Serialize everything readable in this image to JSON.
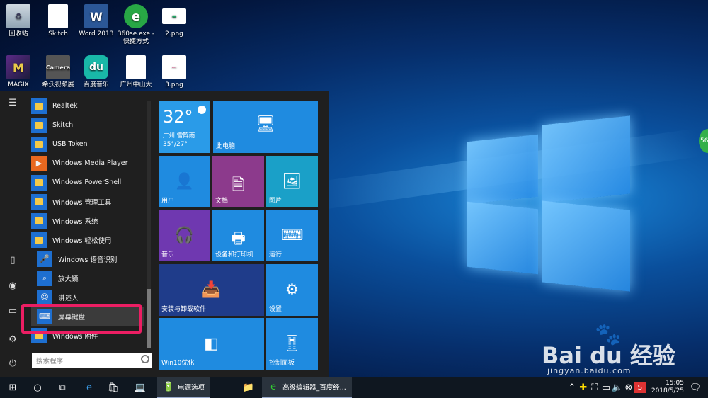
{
  "desktop": {
    "icons": [
      {
        "label": "回收站",
        "glyph": "♻"
      },
      {
        "label": "Skitch",
        "glyph": ""
      },
      {
        "label": "Word 2013",
        "glyph": "W"
      },
      {
        "label": "360se.exe - 快捷方式",
        "glyph": "e"
      },
      {
        "label": "2.png",
        "glyph": "▬"
      },
      {
        "label": "MAGIX",
        "glyph": "M"
      },
      {
        "label": "希沃视频展",
        "glyph": "Camera"
      },
      {
        "label": "百度音乐",
        "glyph": "du"
      },
      {
        "label": "广州中山大",
        "glyph": ""
      },
      {
        "label": "3.png",
        "glyph": "···"
      }
    ]
  },
  "start_menu": {
    "rail": {
      "hamburger": "☰",
      "tablet": "▯",
      "user": "◉",
      "pictures": "▭",
      "settings": "⚙",
      "power": "⏻"
    },
    "apps": [
      {
        "label": "Realtek",
        "type": "folder"
      },
      {
        "label": "Skitch",
        "type": "folder"
      },
      {
        "label": "USB Token",
        "type": "folder"
      },
      {
        "label": "Windows Media Player",
        "type": "app"
      },
      {
        "label": "Windows PowerShell",
        "type": "folder"
      },
      {
        "label": "Windows 管理工具",
        "type": "folder"
      },
      {
        "label": "Windows 系统",
        "type": "folder"
      },
      {
        "label": "Windows 轻松使用",
        "type": "folder"
      },
      {
        "label": "Windows 语音识别",
        "type": "sub"
      },
      {
        "label": "放大镜",
        "type": "sub"
      },
      {
        "label": "讲述人",
        "type": "sub"
      },
      {
        "label": "屏幕键盘",
        "type": "sub-selected"
      },
      {
        "label": "Windows 附件",
        "type": "folder"
      }
    ],
    "search_placeholder": "搜索程序",
    "tiles": {
      "weather": {
        "temp": "32°",
        "city": "广州 雷阵雨",
        "range": "35°/27°"
      },
      "this_pc": "此电脑",
      "users": "用户",
      "docs": "文档",
      "pictures": "图片",
      "music": "音乐",
      "devices": "设备和打印机",
      "run": "运行",
      "uninstall": "安装与卸载软件",
      "settings": "设置",
      "win10": "Win10优化",
      "control": "控制面板"
    }
  },
  "taskbar": {
    "power_options": "电源选项",
    "editor": "高级编辑器_百度经...",
    "time": "15:05",
    "date": "2018/5/25"
  },
  "watermark": {
    "brand": "Bai du 经验",
    "url": "jingyan.baidu.com"
  },
  "side_badge": "56"
}
